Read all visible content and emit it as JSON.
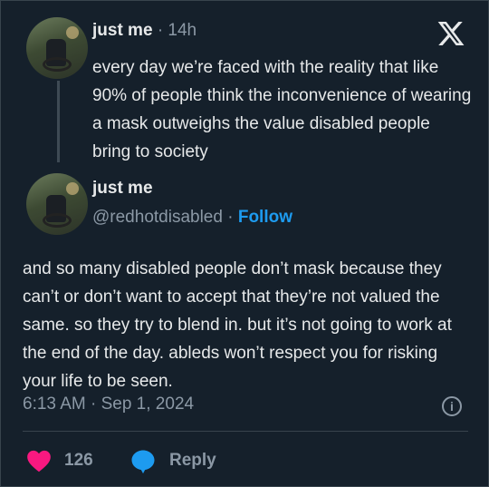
{
  "tweet1": {
    "name": "just me",
    "time": "14h",
    "text": "every day we’re faced with the reality that like 90% of people think the inconvenience of wearing a mask outweighs the value disabled people bring to society"
  },
  "tweet2": {
    "name": "just me",
    "handle": "@redhotdisabled",
    "follow": "Follow",
    "text": "and so many disabled people don’t mask because they can’t or don’t want to accept that they’re not valued the same. so they try to blend in. but it’s not going to work at the end of the day. ableds won’t respect you for risking your life to be seen.",
    "timestamp": "6:13 AM · Sep 1, 2024"
  },
  "actions": {
    "like_count": "126",
    "reply_label": "Reply"
  },
  "icons": {
    "logo": "x-logo-icon",
    "info": "info-icon",
    "like": "heart-icon",
    "reply": "reply-bubble-icon"
  },
  "colors": {
    "background": "#15202b",
    "text": "#e7e9ea",
    "muted": "#8b98a5",
    "link": "#1d9bf0",
    "heart": "#f91880",
    "reply_bubble": "#1d9bf0"
  }
}
